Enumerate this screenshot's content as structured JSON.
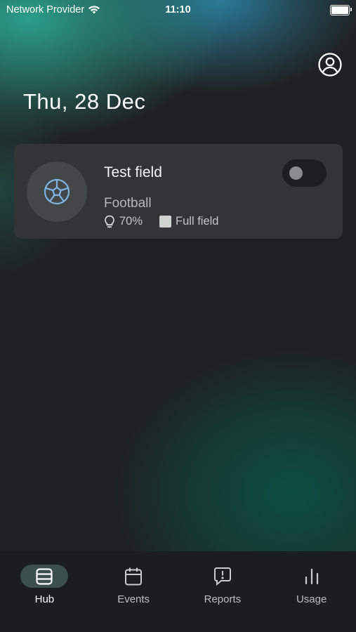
{
  "status_bar": {
    "carrier": "Network Provider",
    "time": "11:10"
  },
  "header": {
    "date": "Thu, 28 Dec",
    "profile_icon": "account-circle-icon"
  },
  "field_card": {
    "name": "Test field",
    "sport": "Football",
    "sport_icon": "football-icon",
    "lighting_icon": "lightbulb-icon",
    "lighting": "70%",
    "size": "Full field",
    "size_color": "#d0d4d0",
    "enabled": false
  },
  "bottom_nav": {
    "items": [
      {
        "label": "Hub",
        "icon": "hub-icon",
        "active": true
      },
      {
        "label": "Events",
        "icon": "calendar-icon",
        "active": false
      },
      {
        "label": "Reports",
        "icon": "report-icon",
        "active": false
      },
      {
        "label": "Usage",
        "icon": "bar-chart-icon",
        "active": false
      }
    ]
  },
  "colors": {
    "accent_teal": "#2b9e8c",
    "background": "#1f2021",
    "card": "#323435",
    "nav_active": "#3b4f4b",
    "sport_icon": "#7fb3e3"
  }
}
